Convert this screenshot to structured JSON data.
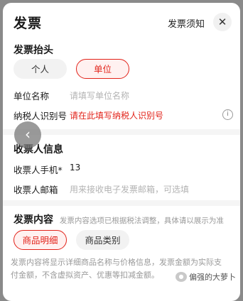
{
  "header": {
    "title": "发票",
    "notice_label": "发票须知",
    "close_glyph": "✕"
  },
  "invoice_title": {
    "section_label": "发票抬头",
    "options": [
      "个人",
      "单位"
    ],
    "selected": "单位"
  },
  "company": {
    "name_label": "单位名称",
    "name_placeholder": "请填写单位名称",
    "tax_label": "纳税人识别号",
    "tax_error": "请在此填写纳税人识别号",
    "info_glyph": "i"
  },
  "recipient": {
    "section_label": "收票人信息",
    "phone_label": "收票人手机*",
    "phone_value": "13",
    "email_label": "收票人邮箱",
    "email_placeholder": "用来接收电子发票邮箱，可选填"
  },
  "content": {
    "section_label": "发票内容",
    "section_hint": "发票内容选项已根据税法调整，具体请以展示为准",
    "options": [
      "商品明细",
      "商品类别"
    ],
    "selected": "商品明细",
    "note": "发票内容将显示详细商品名称与价格信息，发票金额为实际支付金额，不含虚拟资产、优惠等扣减金额。"
  },
  "overlay": {
    "back_glyph": "‹",
    "watermark_text": "偏强的大萝卜"
  },
  "colors": {
    "accent": "#e2231a",
    "accent_bg": "#fff1f0",
    "placeholder": "#b3b3b3"
  }
}
